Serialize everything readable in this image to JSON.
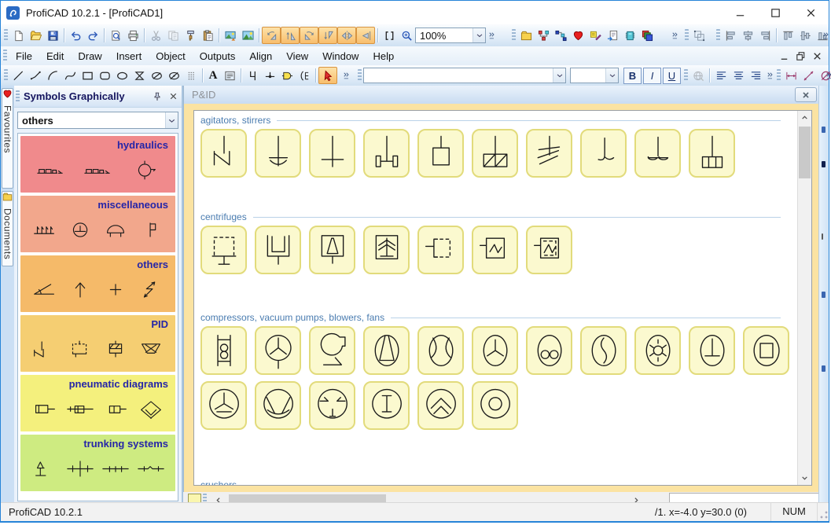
{
  "window": {
    "title": "ProfiCAD 10.2.1 - [ProfiCAD1]"
  },
  "menu": {
    "items": [
      "File",
      "Edit",
      "Draw",
      "Insert",
      "Object",
      "Outputs",
      "Align",
      "View",
      "Window",
      "Help"
    ]
  },
  "toolbars": {
    "standard": [
      "grip",
      "new-file",
      "open-folder",
      "save",
      "|",
      "undo",
      "redo",
      "|",
      "print-preview",
      "print",
      "|",
      "cut:d",
      "copy:d",
      "format-painter",
      "paste",
      "|",
      "export-image",
      "picture",
      "|",
      "rotate-left:a",
      "flip-up:a",
      "rotate-right:a",
      "flip-down:a",
      "mirror-horizontal:a",
      "mirror-left:a",
      "|",
      "selection-brackets",
      "zoom-in"
    ],
    "zoom_value": "100%",
    "panels": [
      "grip",
      "folder",
      "symbols-graphically",
      "symbols-tree",
      "favourites-heart",
      "notes",
      "sheet-export",
      "integrated-circuit",
      "layers"
    ],
    "group": [
      "grip",
      "group-objects"
    ],
    "align": [
      "grip",
      "align-left-edges",
      "align-centers",
      "align-right-edges",
      "|",
      "align-top-edges",
      "align-middles",
      "align-bottom-edges"
    ],
    "draw": [
      "grip",
      "line",
      "polyline",
      "arc",
      "bezier",
      "rectangle",
      "rounded-rectangle",
      "ellipse",
      "hourglass",
      "ellipse-slash",
      "ellipse-slash-dot",
      "list-lines",
      "|",
      "L:text_tool",
      "text-block",
      "|",
      "hook-connector",
      "junction-point",
      "gate",
      "brace-connector",
      "|",
      "pointer:a"
    ],
    "text_labels": {
      "text_tool": "A",
      "bold": "B",
      "italic": "I",
      "underline": "U"
    },
    "font_family_value": "",
    "font_size_value": "",
    "text_icons": [
      "grip",
      "translate-globe:d",
      "|",
      "text-align-left",
      "text-align-center",
      "text-align-right"
    ],
    "dimension": [
      "grip",
      "dimension-horizontal",
      "dimension-diagonal",
      "diameter"
    ]
  },
  "sidebar": {
    "title": "Symbols Graphically",
    "dropdown_value": "others",
    "tabs": [
      {
        "label": "Favourites",
        "icon": "favourites-heart"
      },
      {
        "label": "Documents",
        "icon": "folder"
      }
    ],
    "categories": [
      {
        "label": "hydraulics",
        "color": "#F08A8C",
        "symbols": [
          "pump-train",
          "pump-train",
          "gauge-circle"
        ]
      },
      {
        "label": "miscellaneous",
        "color": "#F2A78C",
        "symbols": [
          "comb-rake",
          "earth-circle",
          "dome",
          "flag"
        ]
      },
      {
        "label": "others",
        "color": "#F5BA69",
        "symbols": [
          "angle",
          "arrow-up",
          "plus",
          "lightning"
        ]
      },
      {
        "label": "PID",
        "color": "#F5CE72",
        "symbols": [
          "zigzag-drain",
          "dashed-box",
          "hatch-box",
          "trapezoid-x"
        ]
      },
      {
        "label": "pneumatic diagrams",
        "color": "#F4F07D",
        "symbols": [
          "cylinder",
          "cylinder-rod",
          "small-box",
          "diamond-filter"
        ]
      },
      {
        "label": "trunking systems",
        "color": "#CEEB81",
        "symbols": [
          "pole",
          "cross-line",
          "tick-line",
          "jog-line"
        ]
      }
    ]
  },
  "document": {
    "title": "P&ID",
    "sections": [
      {
        "label": "agitators, stirrers",
        "rows": [
          [
            "agitator-anchor",
            "agitator-arc",
            "agitator-flat",
            "agitator-paddle",
            "agitator-box",
            "agitator-box-diag",
            "agitator-zigzag",
            "agitator-hook",
            "agitator-propeller",
            "agitator-grid"
          ]
        ]
      },
      {
        "label": "centrifuges",
        "rows": [
          [
            "centrifuge-dashed",
            "centrifuge-open",
            "centrifuge-cone",
            "centrifuge-chevrons",
            "centrifuge-dashed-line",
            "centrifuge-wave",
            "centrifuge-wave-dashed"
          ]
        ]
      },
      {
        "label": "compressors, vacuum pumps, blowers, fans",
        "rows": [
          [
            "compressor-roots",
            "fan-blades",
            "blower",
            "compressor-cone",
            "compressor-curves",
            "fan-propeller",
            "compressor-lobes",
            "compressor-screw",
            "compressor-star",
            "compressor-tee",
            "compressor-box"
          ],
          [
            "fan-propeller-bar",
            "compressor-trapezoid",
            "compressor-arrows",
            "compressor-ibar",
            "compressor-chevrons",
            "compressor-ring"
          ]
        ]
      },
      {
        "label": "crushers",
        "rows": []
      }
    ]
  },
  "statusbar": {
    "app_version": "ProfiCAD 10.2.1",
    "position": "/1.  x=-4.0  y=30.0 (0)",
    "num_lock": "NUM"
  }
}
